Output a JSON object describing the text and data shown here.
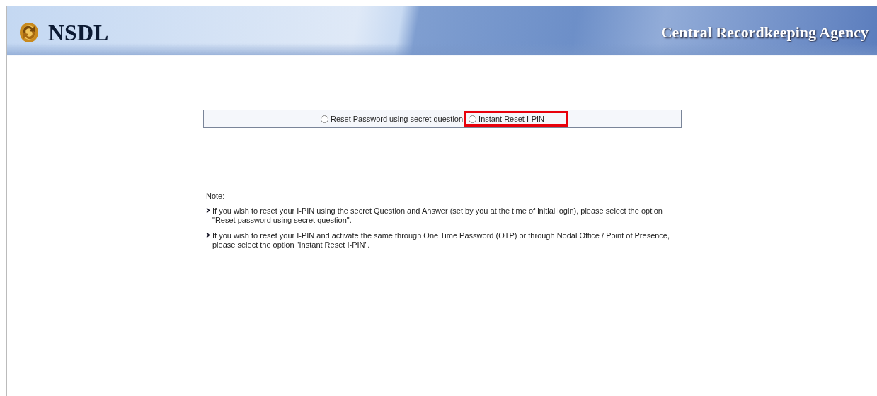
{
  "header": {
    "brand": "NSDL",
    "tagline": "Central Recordkeeping Agency"
  },
  "options": [
    {
      "label": "Reset Password using secret question",
      "selected": false,
      "highlighted": false
    },
    {
      "label": "Instant Reset I-PIN",
      "selected": false,
      "highlighted": true
    }
  ],
  "note": {
    "title": "Note:",
    "items": [
      "If you wish to reset your I-PIN using the secret Question and Answer (set by you at the time of initial login), please select the option \"Reset password using secret question\".",
      "If you wish to reset your I-PIN and activate the same through One Time Password (OTP) or through Nodal Office / Point of Presence, please select the option \"Instant Reset I-PIN\"."
    ]
  }
}
